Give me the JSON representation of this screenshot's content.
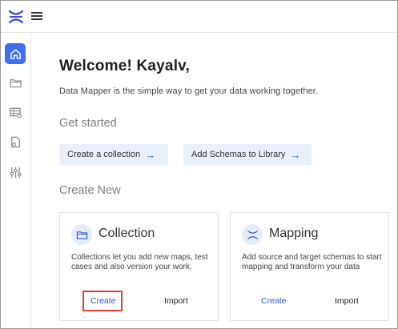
{
  "header": {
    "logo_icon": "x-logo-icon",
    "menu_icon": "hamburger-menu-icon"
  },
  "sidebar": {
    "items": [
      {
        "icon": "home-icon",
        "active": true
      },
      {
        "icon": "folder-icon",
        "active": false
      },
      {
        "icon": "table-map-icon",
        "active": false
      },
      {
        "icon": "document-icon",
        "active": false
      },
      {
        "icon": "sliders-icon",
        "active": false
      }
    ],
    "accent_color": "#3d6ff0"
  },
  "main": {
    "welcome": "Welcome! Kayalv,",
    "subtitle": "Data Mapper is the simple way to get your data working together.",
    "get_started": {
      "heading": "Get started",
      "actions": [
        {
          "label": "Create a collection",
          "arrow": "→"
        },
        {
          "label": "Add Schemas to Library",
          "arrow": "→"
        }
      ]
    },
    "create_new": {
      "heading": "Create New",
      "cards": [
        {
          "icon": "folder-icon",
          "title": "Collection",
          "description": "Collections let you add new maps, test cases and also version your work.",
          "create_label": "Create",
          "import_label": "Import",
          "create_highlighted": true
        },
        {
          "icon": "mapping-icon",
          "title": "Mapping",
          "description": "Add source and target schemas to start mapping and transform your data",
          "create_label": "Create",
          "import_label": "Import",
          "create_highlighted": false
        }
      ]
    }
  },
  "colors": {
    "chip_bg": "#eaf0fb",
    "link_blue": "#2f56c5",
    "highlight_red": "#e0403a"
  }
}
